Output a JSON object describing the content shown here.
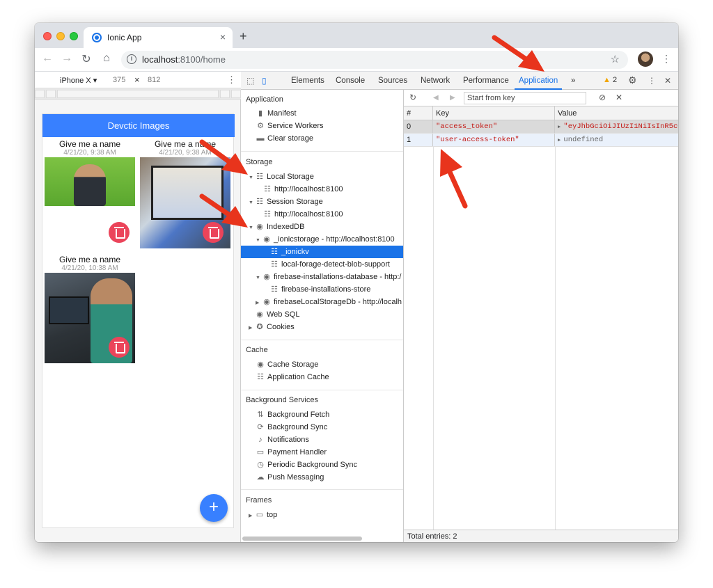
{
  "browser": {
    "tab_title": "Ionic App",
    "tab_close": "×",
    "new_tab": "+",
    "url_host": "localhost",
    "url_rest": ":8100/home",
    "back": "←",
    "forward": "→",
    "reload": "↻",
    "home": "⌂",
    "star": "☆",
    "menu": "⋮"
  },
  "device_toolbar": {
    "device": "iPhone X ▾",
    "width": "375",
    "times": "×",
    "height": "812",
    "more": "⋮"
  },
  "app": {
    "header": "Devctic Images",
    "cards": [
      {
        "title": "Give me a name",
        "date": "4/21/20, 9:38 AM"
      },
      {
        "title": "Give me a name",
        "date": "4/21/20, 9:38 AM"
      },
      {
        "title": "Give me a name",
        "date": "4/21/20, 10:38 AM"
      }
    ],
    "fab_add": "+"
  },
  "devtools": {
    "tabs": [
      "Elements",
      "Console",
      "Sources",
      "Network",
      "Performance",
      "Application"
    ],
    "active_tab": "Application",
    "overflow": "»",
    "warnings": "2",
    "close": "✕",
    "sidebar": {
      "application_head": "Application",
      "application_items": [
        "Manifest",
        "Service Workers",
        "Clear storage"
      ],
      "storage_head": "Storage",
      "local_storage": "Local Storage",
      "local_storage_origin": "http://localhost:8100",
      "session_storage": "Session Storage",
      "session_storage_origin": "http://localhost:8100",
      "indexeddb": "IndexedDB",
      "ionicstorage": "_ionicstorage - http://localhost:8100",
      "ionickv": "_ionickv",
      "local_forage": "local-forage-detect-blob-support",
      "firebase_db": "firebase-installations-database - http:/",
      "firebase_store": "firebase-installations-store",
      "firebase_local": "firebaseLocalStorageDb - http://localh",
      "web_sql": "Web SQL",
      "cookies": "Cookies",
      "cache_head": "Cache",
      "cache_items": [
        "Cache Storage",
        "Application Cache"
      ],
      "bg_head": "Background Services",
      "bg_items": [
        "Background Fetch",
        "Background Sync",
        "Notifications",
        "Payment Handler",
        "Periodic Background Sync",
        "Push Messaging"
      ],
      "frames_head": "Frames",
      "frames_top": "top"
    },
    "storage_table": {
      "filter_placeholder": "Start from key",
      "columns": [
        "#",
        "Key",
        "Value"
      ],
      "rows": [
        {
          "index": "0",
          "key": "\"access_token\"",
          "value": "\"eyJhbGciOiJIUzI1NiIsInR5cC"
        },
        {
          "index": "1",
          "key": "\"user-access-token\"",
          "value": "undefined"
        }
      ],
      "footer": "Total entries: 2"
    }
  },
  "colors": {
    "ionic_primary": "#3880ff",
    "ionic_danger": "#eb445a",
    "devtools_selected": "#1a73e8",
    "annotation_arrow": "#e8341c"
  }
}
